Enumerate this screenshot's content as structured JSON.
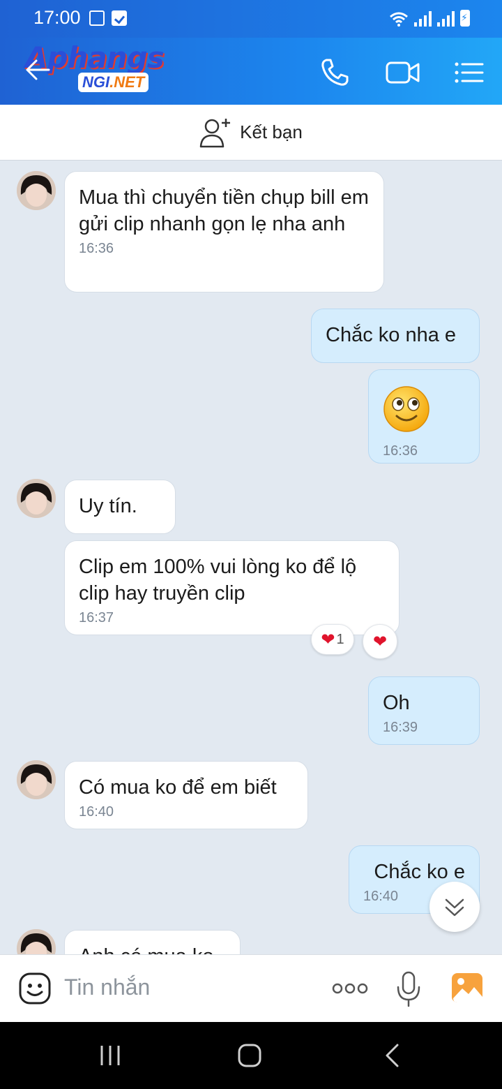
{
  "status_bar": {
    "time": "17:00"
  },
  "header": {
    "logo_text": "Aphangs",
    "logo_tag_prefix": "NGI",
    "logo_tag_suffix": ".NET",
    "icons": [
      "back-arrow-icon",
      "phone-icon",
      "video-call-icon",
      "menu-list-icon"
    ]
  },
  "friend_bar": {
    "label": "Kết bạn"
  },
  "messages": [
    {
      "side": "in",
      "text": "Mua thì chuyển tiền chụp bill em gửi clip nhanh gọn lẹ nha anh",
      "time": "16:36"
    },
    {
      "side": "out",
      "text": "Chắc ko nha e"
    },
    {
      "side": "out",
      "sticker": "smile-emoji",
      "time": "16:36"
    },
    {
      "side": "in",
      "text": "Uy tín."
    },
    {
      "side": "in",
      "text": "Clip em 100% vui lòng ko để lộ clip hay truyền clip",
      "time": "16:37",
      "reaction_count": "1"
    },
    {
      "side": "out",
      "text": "Oh",
      "time": "16:39"
    },
    {
      "side": "in",
      "text": "Có mua ko để em biết",
      "time": "16:40"
    },
    {
      "side": "out",
      "text": "Chắc ko e",
      "time": "16:40"
    },
    {
      "side": "in",
      "text": "Anh có mua ko"
    }
  ],
  "input_bar": {
    "placeholder": "Tin nhắn"
  },
  "colors": {
    "header_start": "#1f62d3",
    "header_end": "#22a7f7",
    "chat_bg": "#e2e9f1",
    "out_bubble": "#d5edfd",
    "in_bubble": "#ffffff",
    "heart": "#e0142c"
  }
}
